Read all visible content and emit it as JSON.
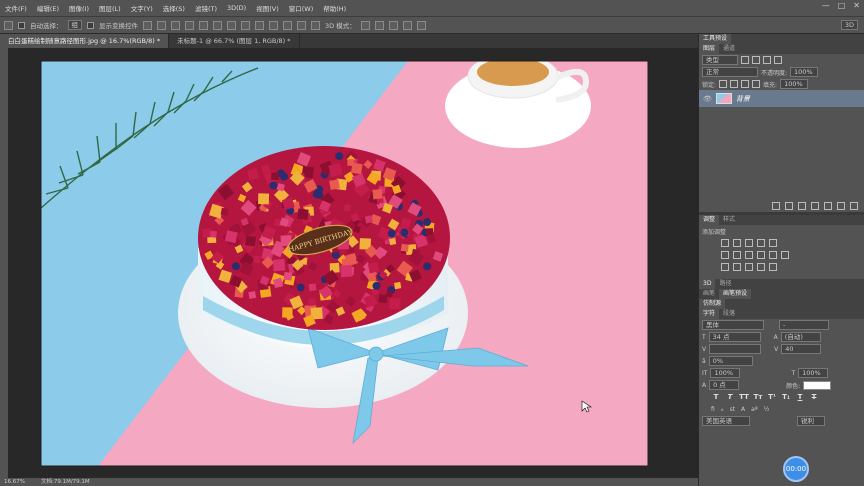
{
  "menu": [
    "文件(F)",
    "编辑(E)",
    "图像(I)",
    "图层(L)",
    "文字(Y)",
    "选择(S)",
    "滤镜(T)",
    "3D(D)",
    "视图(V)",
    "窗口(W)",
    "帮助(H)"
  ],
  "window_controls": {
    "min": "—",
    "max": "□",
    "close": "✕"
  },
  "options": {
    "auto_select": "自动选择：",
    "target": "组",
    "show_transform": "显示变换控件",
    "mode_3d": "3D 模式：",
    "workspace": "3D"
  },
  "tabs": [
    {
      "label": "白白蛋糕绘制随意路径图形.jpg @ 16.7%(RGB/8) *"
    },
    {
      "label": "未标题-1 @ 66.7% (图层 1, RGB/8) *"
    }
  ],
  "status": {
    "zoom": "16.67%",
    "doc": "文档:79.1M/79.1M"
  },
  "cake_text": "HAPPY BIRTHDAY",
  "panel": {
    "tool_presets": "工具预设",
    "layers_tabs": [
      "图层",
      "通道"
    ],
    "kind": "类型",
    "blend": "正常",
    "opacity_label": "不透明度:",
    "opacity": "100%",
    "lock_label": "锁定:",
    "fill_label": "填充:",
    "fill": "100%",
    "layer_name": "背景",
    "adjust_tabs": [
      "调整",
      "样式"
    ],
    "adjust_title": "添加调整",
    "tabs_3d": [
      "3D",
      "路径"
    ],
    "tabs_brush": [
      "画笔",
      "画笔预设"
    ],
    "tab_clone": "仿制源",
    "char_tabs": [
      "字符",
      "段落"
    ],
    "font": "黑体",
    "font_style": "-",
    "size": "34 点",
    "leading": "(自动)",
    "tracking": "40",
    "scale_pct": "0%",
    "vscale": "100%",
    "hscale": "100%",
    "baseline": "0 点",
    "color_label": "颜色:",
    "lang": "美国英语",
    "aa": "锐利"
  },
  "clock": "00:00",
  "colors": {
    "sky": "#8ccbe9",
    "pink": "#f5a8c2",
    "ui": "#535353"
  }
}
